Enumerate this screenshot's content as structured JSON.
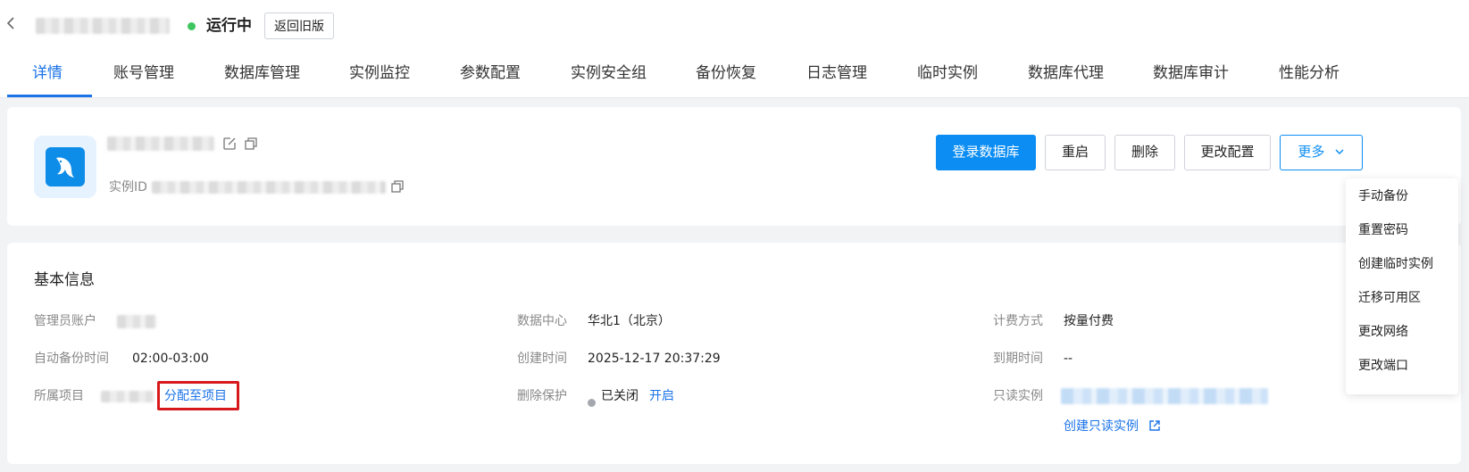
{
  "header": {
    "status_text": "运行中",
    "old_version_label": "返回旧版"
  },
  "tabs": [
    {
      "label": "详情"
    },
    {
      "label": "账号管理"
    },
    {
      "label": "数据库管理"
    },
    {
      "label": "实例监控"
    },
    {
      "label": "参数配置"
    },
    {
      "label": "实例安全组"
    },
    {
      "label": "备份恢复"
    },
    {
      "label": "日志管理"
    },
    {
      "label": "临时实例"
    },
    {
      "label": "数据库代理"
    },
    {
      "label": "数据库审计"
    },
    {
      "label": "性能分析"
    }
  ],
  "instance": {
    "id_label": "实例ID"
  },
  "actions": {
    "login_db": "登录数据库",
    "restart": "重启",
    "delete": "删除",
    "change_config": "更改配置",
    "more": "更多"
  },
  "more_menu": [
    "手动备份",
    "重置密码",
    "创建临时实例",
    "迁移可用区",
    "更改网络",
    "更改端口"
  ],
  "basic_info": {
    "title": "基本信息",
    "admin_account_label": "管理员账户",
    "auto_backup_label": "自动备份时间",
    "auto_backup_value": "02:00-03:00",
    "project_label": "所属项目",
    "assign_project_link": "分配至项目",
    "datacenter_label": "数据中心",
    "datacenter_value": "华北1（北京）",
    "create_time_label": "创建时间",
    "create_time_value": "2025-12-17 20:37:29",
    "delete_protect_label": "删除保护",
    "delete_protect_value": "已关闭",
    "enable_link": "开启",
    "billing_label": "计费方式",
    "billing_value": "按量付费",
    "expire_label": "到期时间",
    "expire_value": "--",
    "readonly_label": "只读实例",
    "create_readonly_link": "创建只读实例"
  },
  "colors": {
    "accent": "#0b8df3",
    "link": "#1a73e8",
    "status_running": "#3ec55f",
    "highlight": "#d7191c"
  }
}
